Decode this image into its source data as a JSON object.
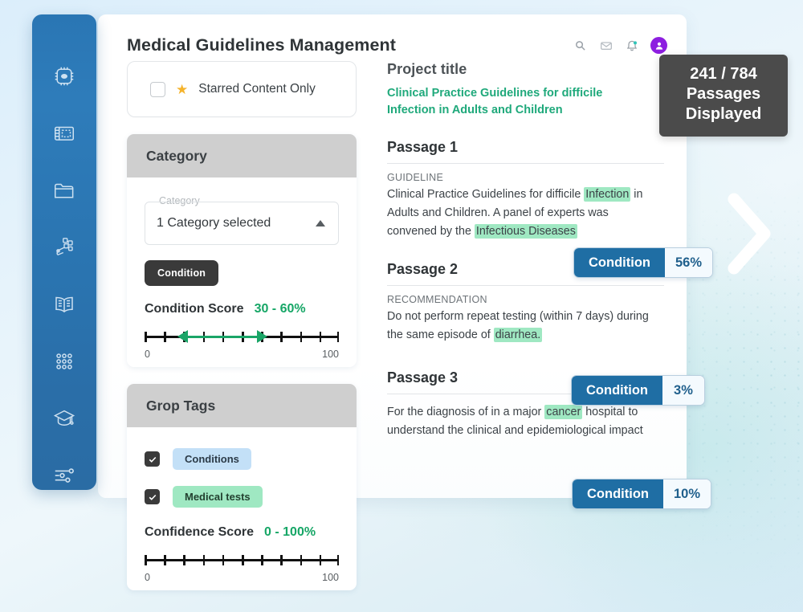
{
  "header": {
    "title": "Medical Guidelines Management",
    "icons": [
      {
        "name": "search-icon"
      },
      {
        "name": "mail-icon"
      },
      {
        "name": "notification-bell-icon"
      },
      {
        "name": "avatar"
      }
    ]
  },
  "sidebar": {
    "items": [
      {
        "name": "sidebar-item-processor",
        "icon": "chip-icon"
      },
      {
        "name": "sidebar-item-blueprint",
        "icon": "blueprint-icon"
      },
      {
        "name": "sidebar-item-folder",
        "icon": "folder-icon"
      },
      {
        "name": "sidebar-item-datasets",
        "icon": "data-cluster-icon"
      },
      {
        "name": "sidebar-item-library",
        "icon": "book-icon"
      },
      {
        "name": "sidebar-item-grid",
        "icon": "dot-grid-icon"
      },
      {
        "name": "sidebar-item-training",
        "icon": "graduation-cap-icon"
      },
      {
        "name": "sidebar-item-settings",
        "icon": "sliders-icon"
      }
    ]
  },
  "filters": {
    "starred": {
      "label": "Starred Content Only",
      "checked": false,
      "star_icon": "star-icon"
    },
    "category_panel": {
      "title": "Category",
      "select": {
        "legend": "Category",
        "value": "1 Category selected",
        "caret": "caret-up-icon"
      },
      "chip": "Condition",
      "score": {
        "label": "Condition Score",
        "value": "30 - 60%",
        "min_label": "0",
        "max_label": "100",
        "range_start_pct": 30,
        "range_end_pct": 60
      }
    },
    "group_tags_panel": {
      "title": "Grop Tags",
      "tags": [
        {
          "label": "Conditions",
          "checked": true,
          "color": "#c3e0f7"
        },
        {
          "label": "Medical tests",
          "checked": true,
          "color": "#9fe8c2"
        }
      ],
      "score": {
        "label": "Confidence Score",
        "value": "0 - 100%",
        "min_label": "0",
        "max_label": "100",
        "range_start_pct": 0,
        "range_end_pct": 100
      }
    }
  },
  "content": {
    "project_title_label": "Project title",
    "project_title": "Clinical Practice Guidelines for difficile Infection in Adults and Children",
    "passages": [
      {
        "heading": "Passage 1",
        "kicker": "GUIDELINE",
        "text_parts": [
          {
            "t": "Clinical Practice Guidelines for difficile ",
            "hl": false
          },
          {
            "t": "Infection",
            "hl": true
          },
          {
            "t": " in Adults and Children. A panel of experts was convened by the ",
            "hl": false
          },
          {
            "t": "Infectious Diseases",
            "hl": true
          }
        ],
        "badge": {
          "label": "Condition",
          "value": "56%"
        }
      },
      {
        "heading": "Passage 2",
        "kicker": "RECOMMENDATION",
        "text_parts": [
          {
            "t": "Do not perform repeat testing (within 7 days) during the same episode of ",
            "hl": false
          },
          {
            "t": "diarrhea.",
            "hl": true
          }
        ],
        "badge": {
          "label": "Condition",
          "value": "3%"
        }
      },
      {
        "heading": "Passage 3",
        "kicker": "",
        "text_parts": [
          {
            "t": "For the diagnosis of in a major ",
            "hl": false
          },
          {
            "t": "cancer",
            "hl": true
          },
          {
            "t": " hospital  to understand the clinical and epidemiological impact",
            "hl": false
          }
        ],
        "badge": {
          "label": "Condition",
          "value": "10%"
        }
      }
    ]
  },
  "tooltip": {
    "count": "241 / 784",
    "line2": "Passages",
    "line3": "Displayed"
  },
  "nav": {
    "next_icon": "chevron-right-icon"
  },
  "colors": {
    "sidebar_blue": "#2a76b4",
    "accent_green": "#16a666",
    "badge_blue": "#1f6ea4",
    "highlight_green": "#9fe8c2",
    "highlight_blue": "#c3e0f7",
    "avatar_purple": "#8d1ee0",
    "star_yellow": "#f5b32b"
  }
}
